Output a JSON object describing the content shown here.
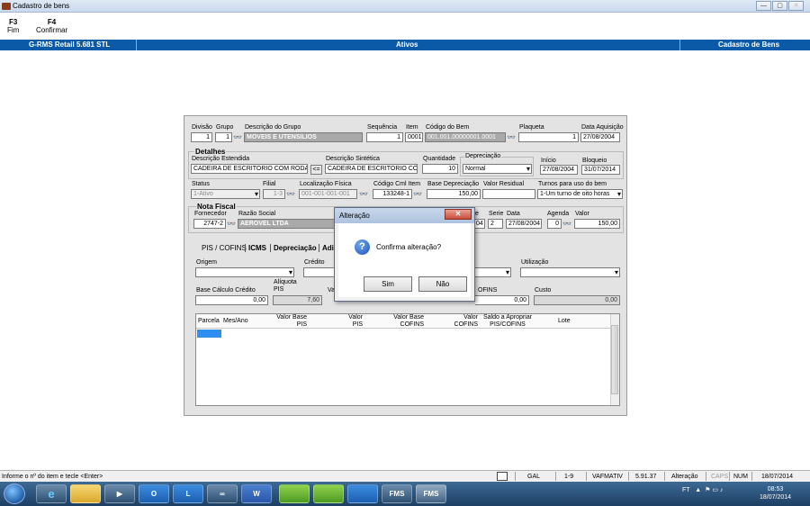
{
  "window": {
    "title": "Cadastro de bens",
    "controls": [
      "—",
      "▢",
      "✕"
    ]
  },
  "fkeys": [
    {
      "key": "F3",
      "label": "Fim"
    },
    {
      "key": "F4",
      "label": "Confirmar"
    }
  ],
  "banner": {
    "left": "G-RMS Retail 5.681 STL",
    "center": "Ativos",
    "right": "Cadastro de Bens"
  },
  "form": {
    "row1": {
      "divisao_label": "Divisão",
      "divisao": "1",
      "grupo_label": "Grupo",
      "grupo": "1",
      "desc_grupo_label": "Descrição do Grupo",
      "desc_grupo": "MOVEIS E UTENSILIOS",
      "sequencia_label": "Sequência",
      "sequencia": "1",
      "item_label": "Item",
      "item": "0001",
      "codigo_bem_label": "Código do Bem",
      "codigo_bem": "001.001.00000001.0001",
      "plaqueta_label": "Plaqueta",
      "plaqueta": "1",
      "data_aquisicao_label": "Data Aquisição",
      "data_aquisicao": "27/08/2004"
    },
    "detalhes": {
      "title": "Detalhes",
      "desc_estendida_label": "Descrição Estendida",
      "desc_estendida": "CADEIRA DE ESCRITORIO COM RODAS",
      "copy_btn": "<=",
      "desc_sintetica_label": "Descrição Sintética",
      "desc_sintetica": "CADEIRA DE ESCRITORIO COM",
      "quantidade_label": "Quantidade",
      "quantidade": "10",
      "depreciacao_label": "Depreciação",
      "depreciacao": "Normal",
      "inicio_label": "Início",
      "inicio": "27/08/2004",
      "bloqueio_label": "Bloqueio",
      "bloqueio": "31/07/2014"
    },
    "row3": {
      "status_label": "Status",
      "status": "1-Ativo",
      "filial_label": "Filial",
      "filial": "1-3",
      "localizacao_label": "Localização Física",
      "localizacao": "001-001-001-001",
      "codigo_cml_label": "Código Cml Item",
      "codigo_cml": "133248-1",
      "base_dep_label": "Base Depreciação",
      "base_dep": "150,00",
      "valor_residual_label": "Valor Residual",
      "valor_residual": "",
      "turnos_label": "Turnos para uso do bem",
      "turnos": "1-Um turno de oito horas"
    },
    "nota_fiscal": {
      "title": "Nota Fiscal",
      "fornecedor_label": "Fornecedor",
      "fornecedor": "2747-2",
      "razao_label": "Razão Social",
      "razao": "AEROVEL LTDA",
      "nf_partial": "04",
      "serie_label": "Serie",
      "serie": "2",
      "data_label": "Data",
      "data": "27/08/2004",
      "agenda_label": "Agenda",
      "agenda": "0",
      "valor_label": "Valor",
      "valor": "150,00",
      "e_label": "e"
    },
    "tabs": [
      "PIS / COFINS",
      "ICMS",
      "Depreciação",
      "Adi"
    ],
    "piscofins": {
      "origem_label": "Origem",
      "credito_label": "Crédito",
      "utilizacao_label": "Utilização",
      "base_calc_label": "Base Cálculo Crédito",
      "base_calc": "0,00",
      "aliquota_label_1": "Alíquota",
      "aliquota_label_2": "PIS",
      "aliquota": "7,60",
      "val_partial": "Val",
      "cofins_partial": "OFINS",
      "cofins_val": "0,00",
      "custo_label": "Custo",
      "custo": "0,00"
    },
    "grid_headers": [
      {
        "l1": "",
        "l2": "Parcela"
      },
      {
        "l1": "",
        "l2": "Mes/Ano"
      },
      {
        "l1": "Valor Base",
        "l2": "PIS"
      },
      {
        "l1": "Valor",
        "l2": "PIS"
      },
      {
        "l1": "Valor Base",
        "l2": "COFINS"
      },
      {
        "l1": "Valor",
        "l2": "COFINS"
      },
      {
        "l1": "Saldo a Apropriar",
        "l2": "PIS/COFINS"
      },
      {
        "l1": "",
        "l2": "Lote"
      }
    ]
  },
  "dialog": {
    "title": "Alteração",
    "close": "✕",
    "message": "Confirma alteração?",
    "yes": "Sim",
    "no": "Não"
  },
  "statusbar": {
    "hint": "Informe o nº do item e tecle <Enter>",
    "gal": "GAL",
    "filial": "1-9",
    "user": "VAFMATIV",
    "version": "5.91.37",
    "mode": "Alteração",
    "caps": "CAPS",
    "num": "NUM",
    "date": "18/07/2014"
  },
  "taskbar": {
    "apps": [
      "ie",
      "explorer",
      "media",
      "outlook",
      "lync",
      "network",
      "word",
      "app1",
      "app2",
      "app3",
      "FMS",
      "FMS"
    ],
    "tray_lang": "FT",
    "time": "08:53",
    "date": "18/07/2014"
  }
}
